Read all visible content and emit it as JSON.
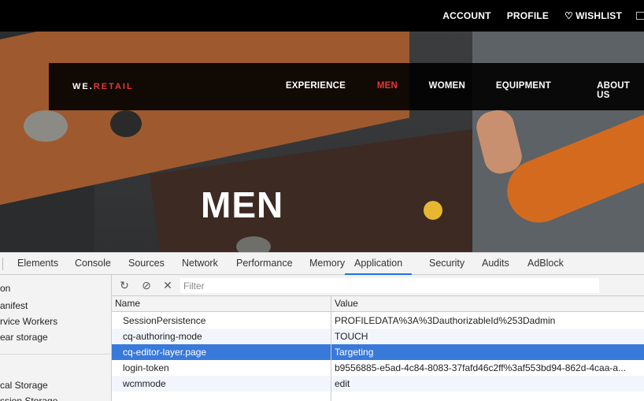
{
  "site": {
    "utility": {
      "account": "ACCOUNT",
      "profile": "PROFILE",
      "wishlist": "WISHLIST"
    },
    "logo": {
      "prefix": "WE.",
      "accent": "RETAIL"
    },
    "nav": [
      "EXPERIENCE",
      "MEN",
      "WOMEN",
      "EQUIPMENT",
      "ABOUT US"
    ],
    "active_nav": "MEN",
    "hero_title": "MEN",
    "colors": {
      "accent": "#e53935",
      "nav_bg": "#000000"
    }
  },
  "devtools": {
    "tabs": [
      "Elements",
      "Console",
      "Sources",
      "Network",
      "Performance",
      "Memory",
      "Application",
      "Security",
      "Audits",
      "AdBlock"
    ],
    "active_tab": "Application",
    "sidebar": {
      "items": [
        "on",
        "anifest",
        "rvice Workers",
        "ear storage"
      ],
      "storage_items": [
        "cal Storage",
        "ssion Storage"
      ]
    },
    "toolbar": {
      "refresh_icon": "refresh-icon",
      "clear_all_icon": "block-icon",
      "delete_icon": "close-icon",
      "filter_placeholder": "Filter"
    },
    "table": {
      "columns": [
        "Name",
        "Value"
      ],
      "rows": [
        {
          "name": "SessionPersistence",
          "value": "PROFILEDATA%3A%3DauthorizableId%253Dadmin"
        },
        {
          "name": "cq-authoring-mode",
          "value": "TOUCH"
        },
        {
          "name": "cq-editor-layer.page",
          "value": "Targeting"
        },
        {
          "name": "login-token",
          "value": "b9556885-e5ad-4c84-8083-37fafd46c2ff%3af553bd94-862d-4caa-a..."
        },
        {
          "name": "wcmmode",
          "value": "edit"
        }
      ],
      "selected_row": 2
    },
    "colors": {
      "selection": "#3879d9",
      "active_tab_underline": "#1a73e8"
    }
  }
}
